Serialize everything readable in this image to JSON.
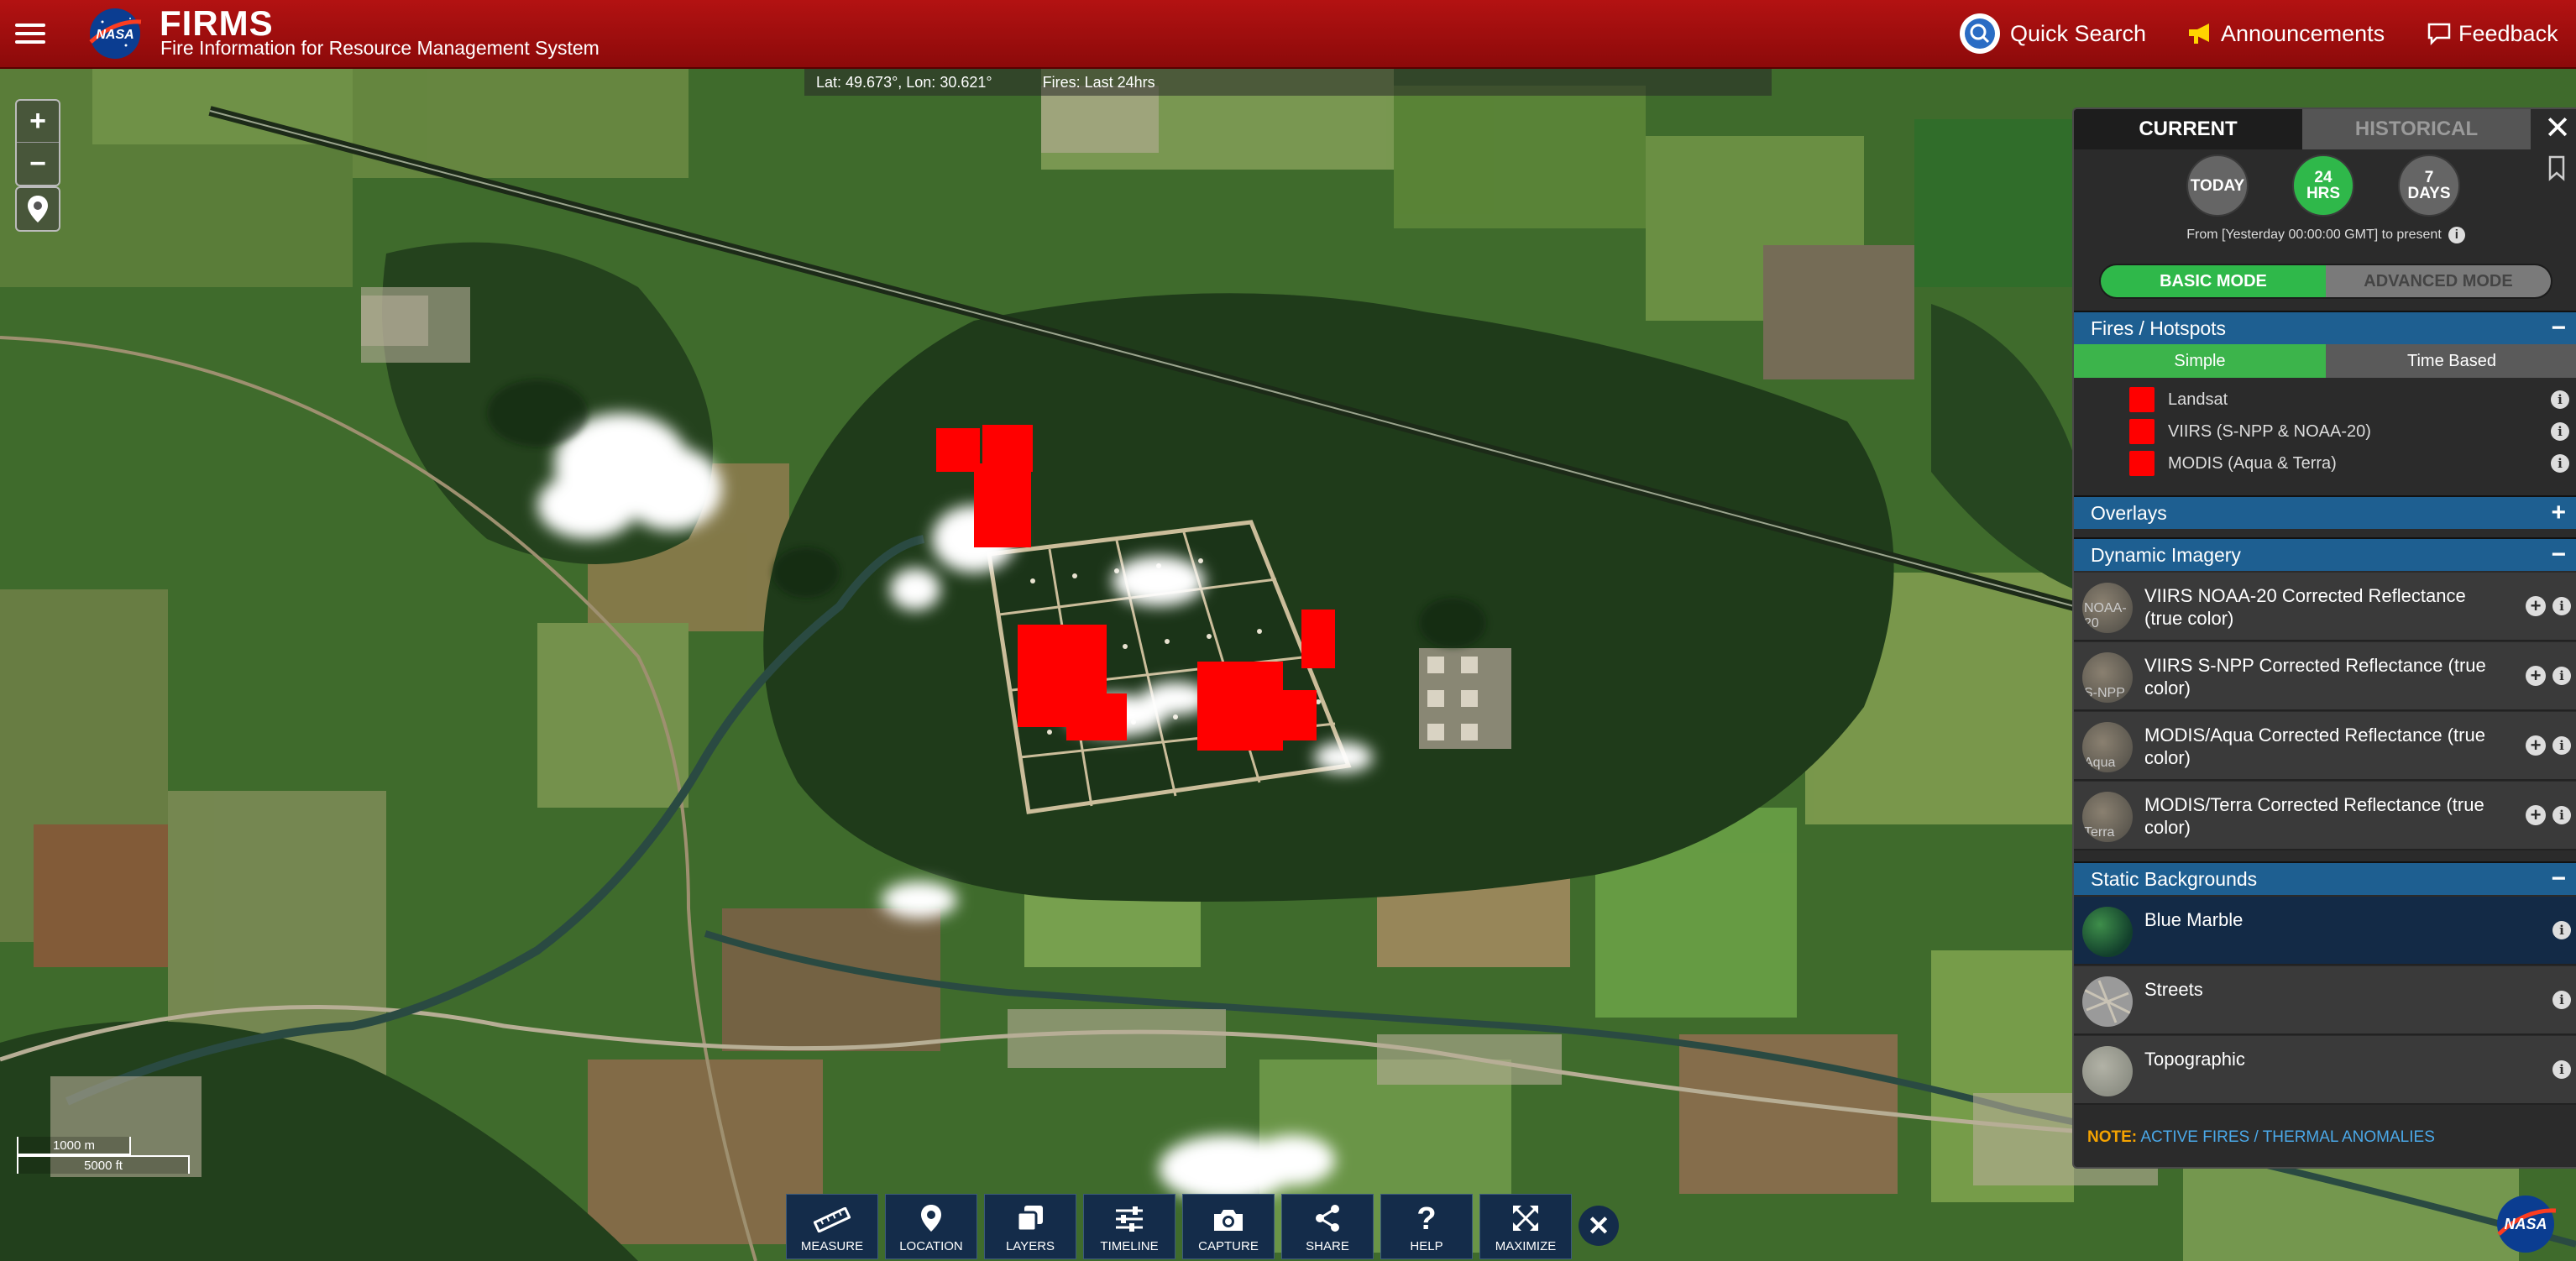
{
  "header": {
    "title": "FIRMS",
    "subtitle": "Fire Information for Resource Management System",
    "nasa_logo_text": "NASA",
    "quick_search": "Quick Search",
    "announcements": "Announcements",
    "feedback": "Feedback"
  },
  "map": {
    "coords": "Lat: 49.673°, Lon: 30.621°",
    "fires_label": "Fires: Last 24hrs",
    "zoom_in": "+",
    "zoom_out": "−",
    "scale_metric": "1000 m",
    "scale_imperial": "5000 ft"
  },
  "toolbar": [
    {
      "label": "MEASURE",
      "icon": "ruler-icon"
    },
    {
      "label": "LOCATION",
      "icon": "location-pin-icon"
    },
    {
      "label": "LAYERS",
      "icon": "layers-icon"
    },
    {
      "label": "TIMELINE",
      "icon": "sliders-icon"
    },
    {
      "label": "CAPTURE",
      "icon": "camera-icon"
    },
    {
      "label": "SHARE",
      "icon": "share-icon"
    },
    {
      "label": "HELP",
      "icon": "question-icon"
    },
    {
      "label": "MAXIMIZE",
      "icon": "maximize-icon"
    }
  ],
  "toolbar_close": "✕",
  "panel": {
    "tab_current": "CURRENT",
    "tab_historical": "HISTORICAL",
    "close": "✕",
    "time_buttons": {
      "today": "TODAY",
      "hrs_num": "24",
      "hrs_unit": "HRS",
      "days_num": "7",
      "days_unit": "DAYS"
    },
    "time_range": "From [Yesterday 00:00:00 GMT] to present",
    "mode_basic": "BASIC MODE",
    "mode_advanced": "ADVANCED MODE",
    "fires_section": "Fires / Hotspots",
    "fires_toggle": "−",
    "subtab_simple": "Simple",
    "subtab_time": "Time Based",
    "fire_layers": [
      "Landsat",
      "VIIRS (S-NPP & NOAA-20)",
      "MODIS (Aqua & Terra)"
    ],
    "fire_color": "#ff0000",
    "overlays_section": "Overlays",
    "overlays_toggle": "+",
    "dynamic_section": "Dynamic Imagery",
    "dynamic_toggle": "−",
    "dynamic_layers": [
      {
        "name": "VIIRS NOAA-20 Corrected Reflectance (true color)",
        "thumb_label": "NOAA-20"
      },
      {
        "name": "VIIRS S-NPP Corrected Reflectance (true color)",
        "thumb_label": "S-NPP"
      },
      {
        "name": "MODIS/Aqua Corrected Reflectance (true color)",
        "thumb_label": "Aqua"
      },
      {
        "name": "MODIS/Terra Corrected Reflectance (true color)",
        "thumb_label": "Terra"
      }
    ],
    "static_section": "Static Backgrounds",
    "static_toggle": "−",
    "static_layers": [
      {
        "name": "Blue Marble",
        "selected": true
      },
      {
        "name": "Streets",
        "selected": false
      },
      {
        "name": "Topographic",
        "selected": false
      }
    ],
    "note_label": "NOTE:",
    "note_link": "ACTIVE FIRES / THERMAL ANOMALIES"
  },
  "colors": {
    "header_red": "#b31212",
    "active_green": "#2fb84a",
    "section_blue": "#1e5f91",
    "toolbar_navy": "#142c4a"
  }
}
